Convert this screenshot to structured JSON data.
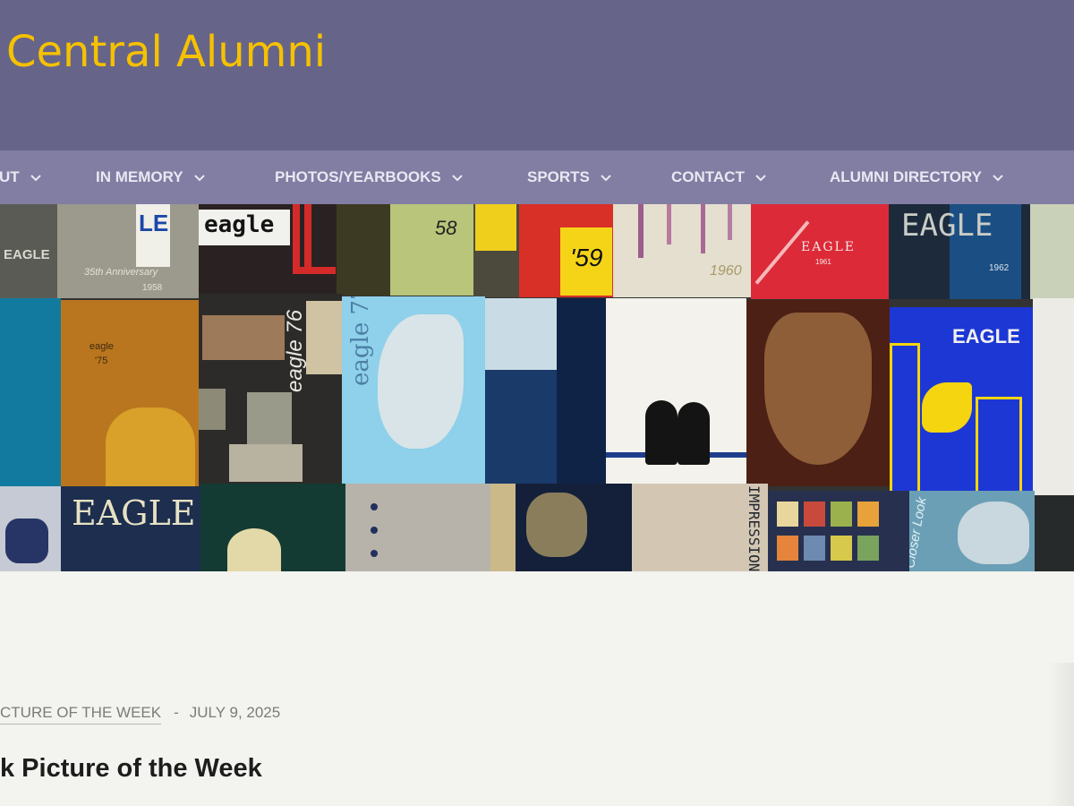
{
  "site": {
    "title": "Central Alumni"
  },
  "nav": {
    "items": [
      {
        "label": "UT"
      },
      {
        "label": "IN MEMORY"
      },
      {
        "label": "PHOTOS/YEARBOOKS"
      },
      {
        "label": "SPORTS"
      },
      {
        "label": "CONTACT"
      },
      {
        "label": "ALUMNI DIRECTORY"
      }
    ]
  },
  "banner": {
    "covers": [
      "EAGLE",
      "LE",
      "35th Anniversary",
      "1958",
      "eagle",
      "58",
      "'59",
      "1960",
      "EAGLE",
      "1961",
      "EAGLE",
      "1962",
      "eagle",
      "'75",
      "eagle 76",
      "eagle 77",
      "EAGLE",
      "EAGLE",
      "EAGLE",
      "IMPRESSIONS",
      "Closer Look"
    ]
  },
  "post": {
    "category": "CTURE OF THE WEEK",
    "separator": "-",
    "date": "JULY 9, 2025",
    "title": "k Picture of the Week"
  }
}
